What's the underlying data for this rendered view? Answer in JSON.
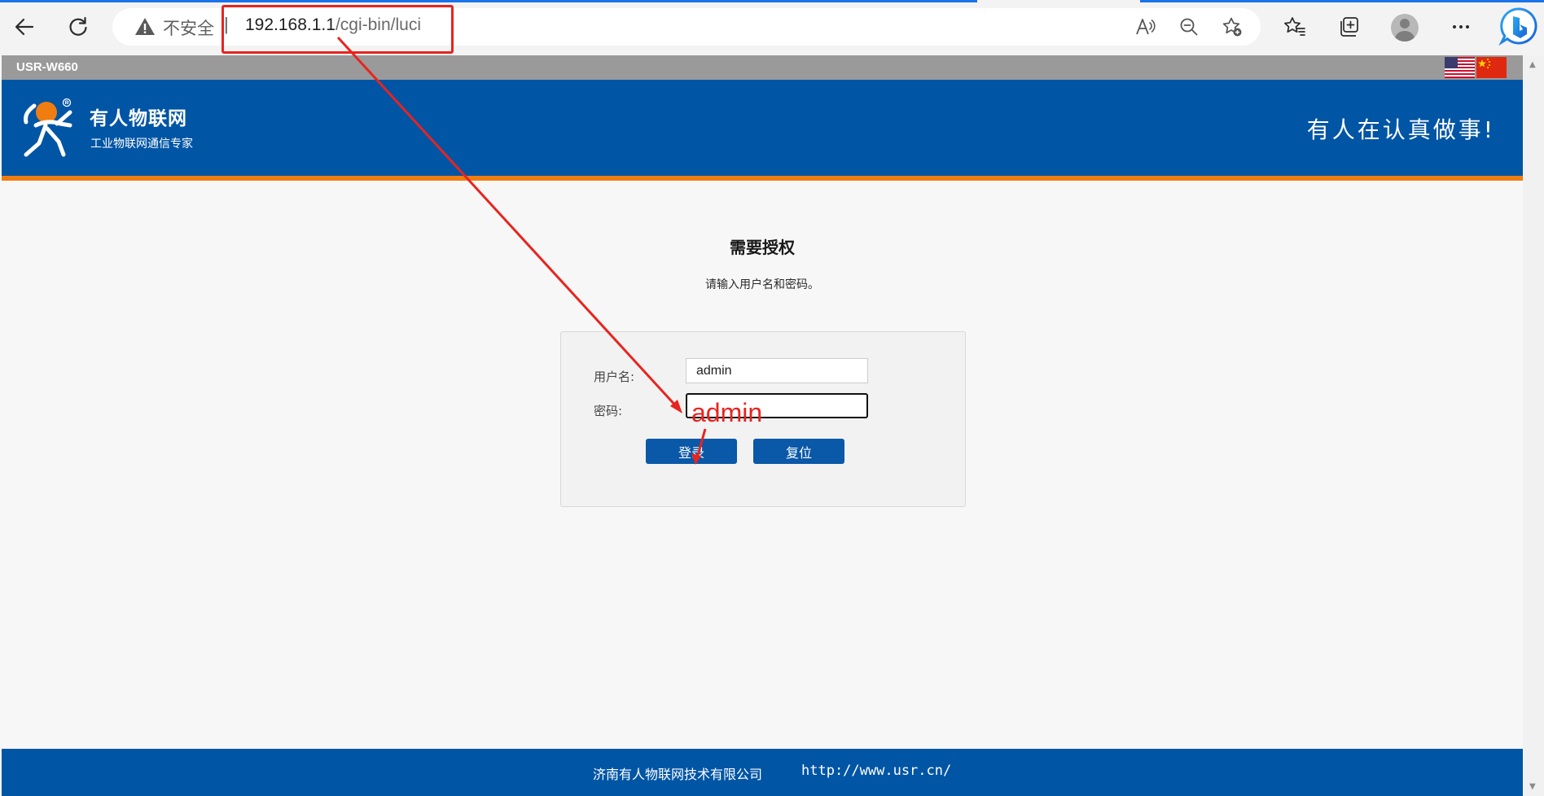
{
  "browser": {
    "security_label": "不安全",
    "separator": "|",
    "url_host": "192.168.1.1",
    "url_path": "/cgi-bin/luci"
  },
  "page": {
    "model": "USR-W660",
    "brand_name": "有人物联网",
    "brand_sub": "工业物联网通信专家",
    "slogan": "有人在认真做事!",
    "auth_title": "需要授权",
    "auth_desc": "请输入用户名和密码。",
    "form": {
      "username_label": "用户名:",
      "username_value": "admin",
      "password_label": "密码:",
      "password_value": "",
      "login_label": "登录",
      "reset_label": "复位"
    },
    "footer": {
      "company": "济南有人物联网技术有限公司",
      "url": "http://www.usr.cn/"
    }
  },
  "annotation": {
    "text": "admin",
    "color": "#e8241f"
  },
  "colors": {
    "header_blue": "#0055a5",
    "accent_orange": "#f07d10",
    "button_blue": "#0a58a8",
    "logo_orange": "#f07d10"
  }
}
